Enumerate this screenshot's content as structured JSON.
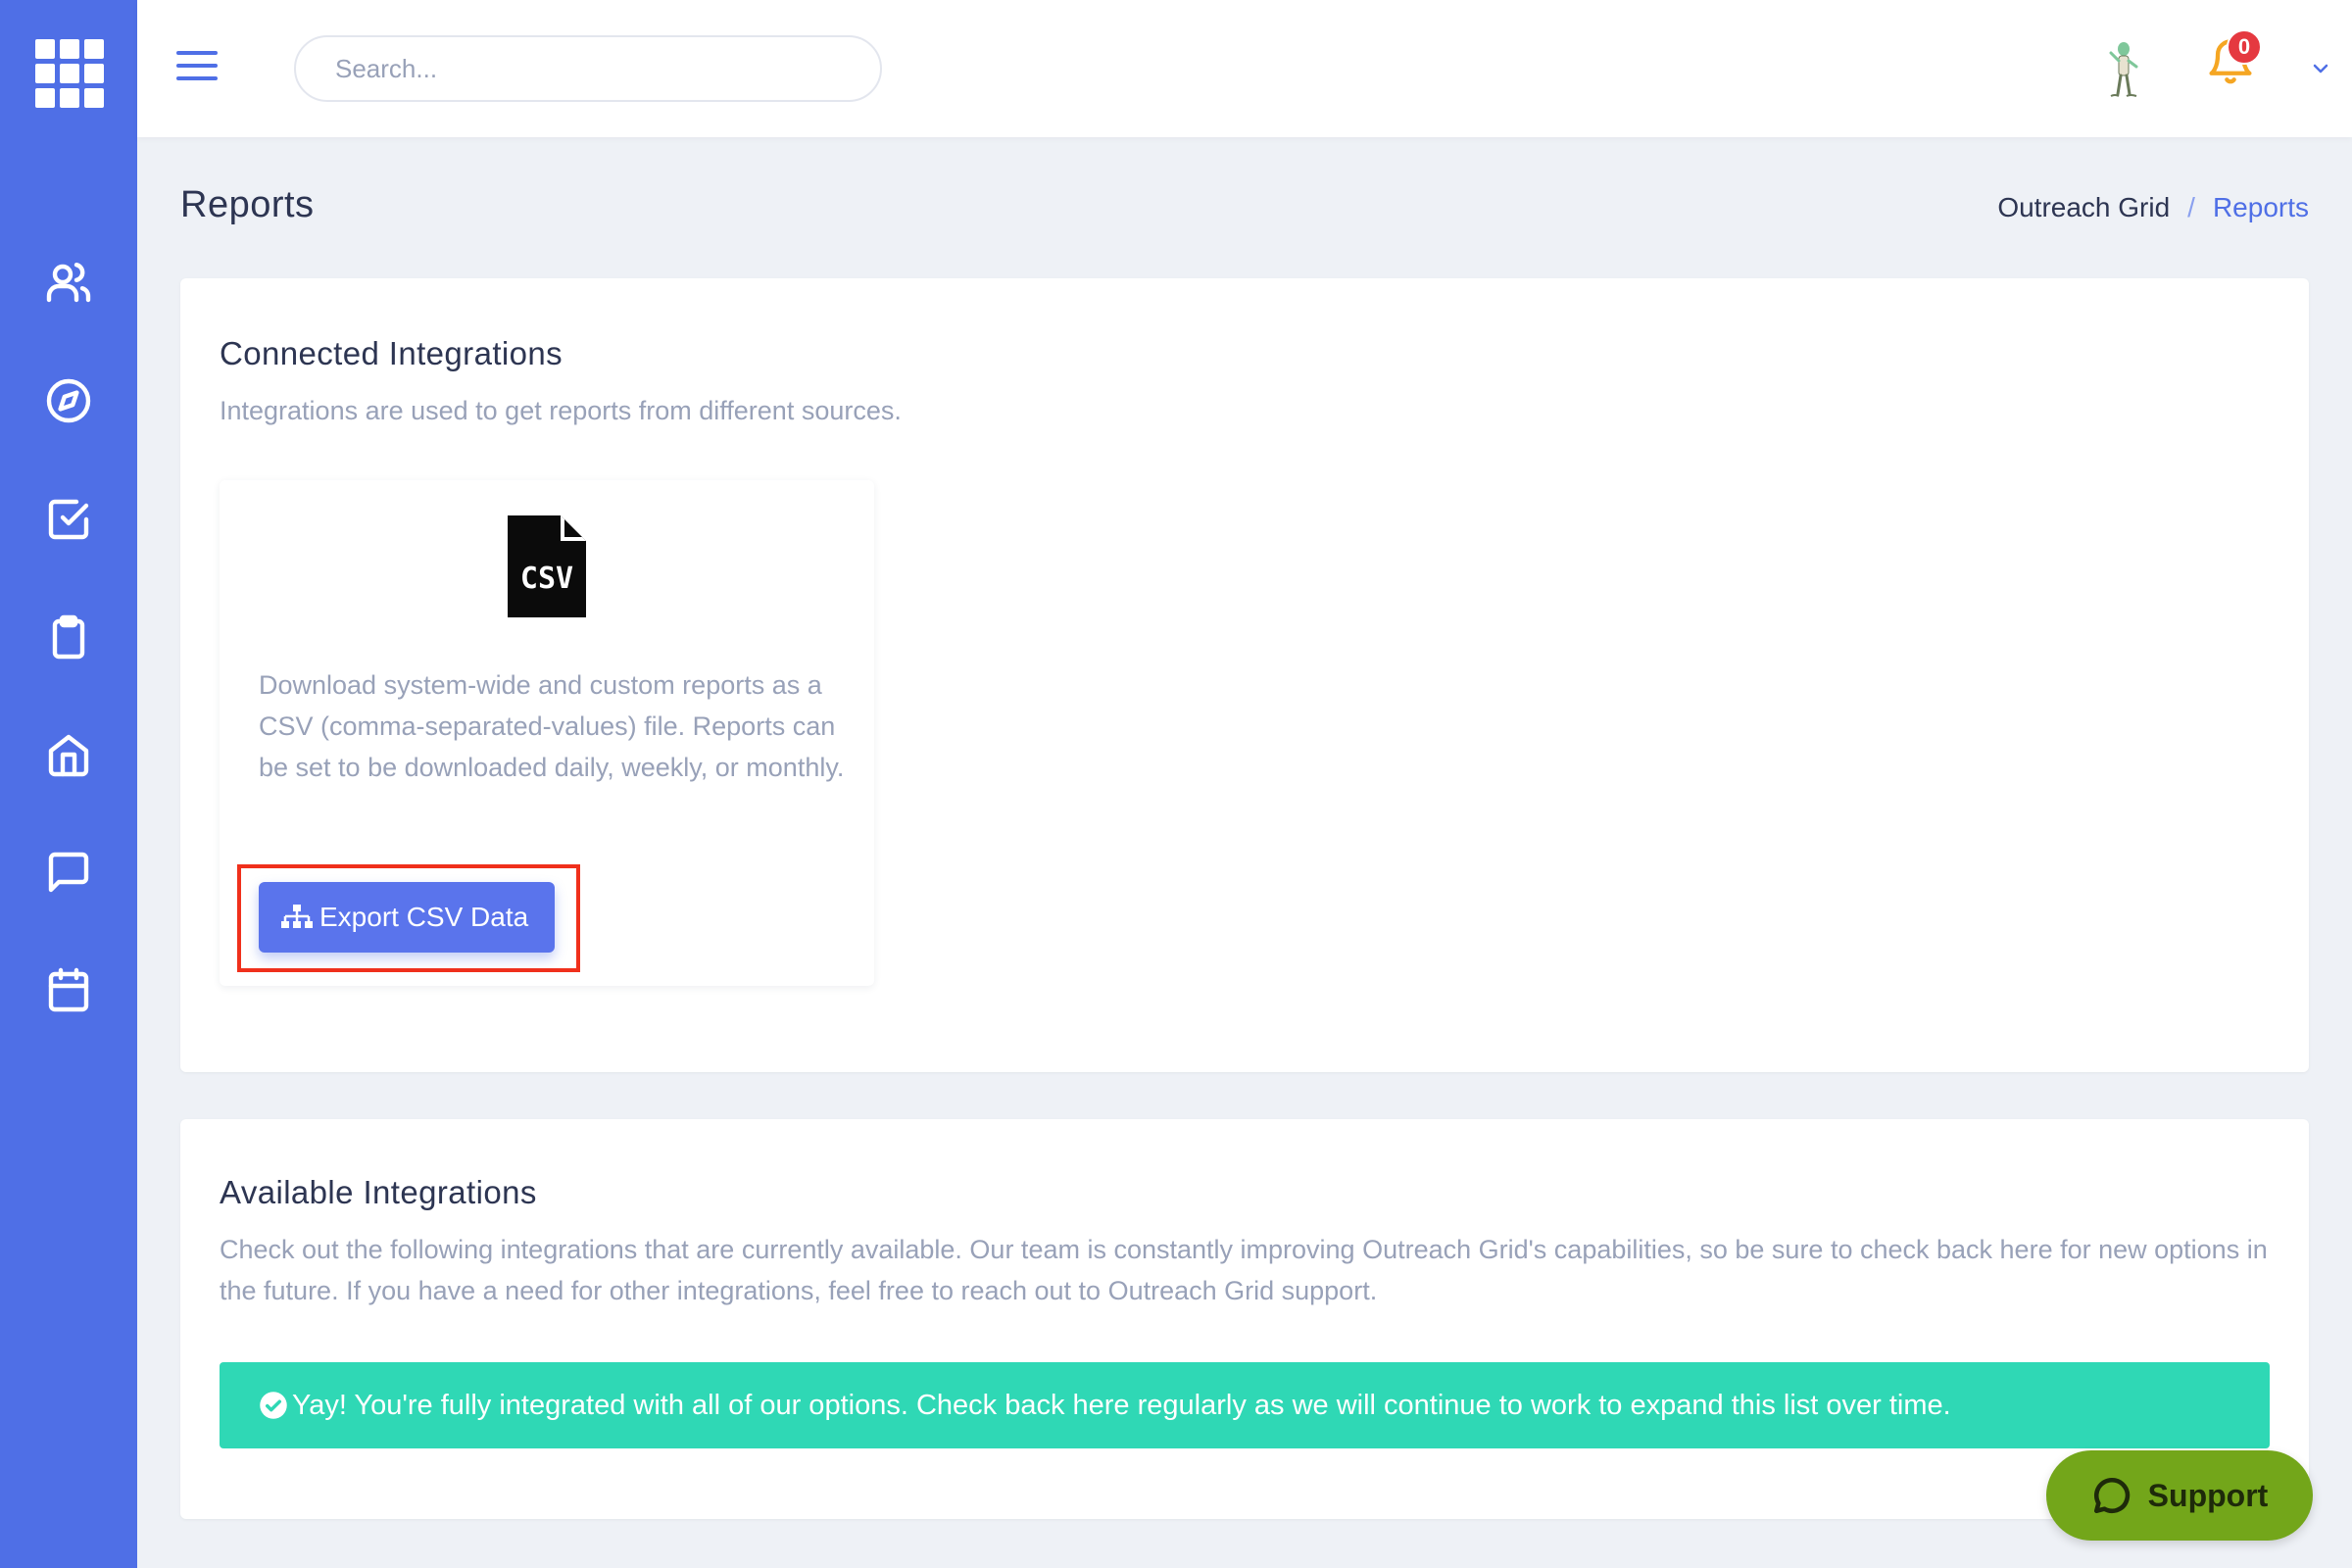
{
  "header": {
    "search_placeholder": "Search...",
    "notification_count": "0"
  },
  "page": {
    "title": "Reports",
    "breadcrumb": [
      {
        "label": "Outreach Grid"
      },
      {
        "label": "Reports"
      }
    ],
    "breadcrumb_separator": "/"
  },
  "connected": {
    "title": "Connected Integrations",
    "subtitle": "Integrations are used to get reports from different sources.",
    "csv_icon_label": "CSV",
    "csv_description": "Download system-wide and custom reports as a CSV (comma-separated-values) file. Reports can be set to be downloaded daily, weekly, or monthly.",
    "export_button": "Export CSV Data"
  },
  "available": {
    "title": "Available Integrations",
    "description": "Check out the following integrations that are currently available. Our team is constantly improving Outreach Grid's capabilities, so be sure to check back here for new options in the future. If you have a need for other integrations, feel free to reach out to Outreach Grid support.",
    "alert": "Yay! You're fully integrated with all of our options. Check back here regularly as we will continue to work to expand this list over time."
  },
  "support": {
    "label": "Support"
  },
  "sidebar": {
    "items": [
      "users-icon",
      "compass-icon",
      "checkbox-icon",
      "clipboard-icon",
      "home-icon",
      "chat-icon",
      "calendar-icon"
    ]
  },
  "colors": {
    "sidebar": "#4f6fe6",
    "accent": "#4f6fe6",
    "alert_success": "#2fd8b5",
    "support_button": "#73a61a",
    "badge": "#e53940",
    "highlight": "#f0301c"
  }
}
